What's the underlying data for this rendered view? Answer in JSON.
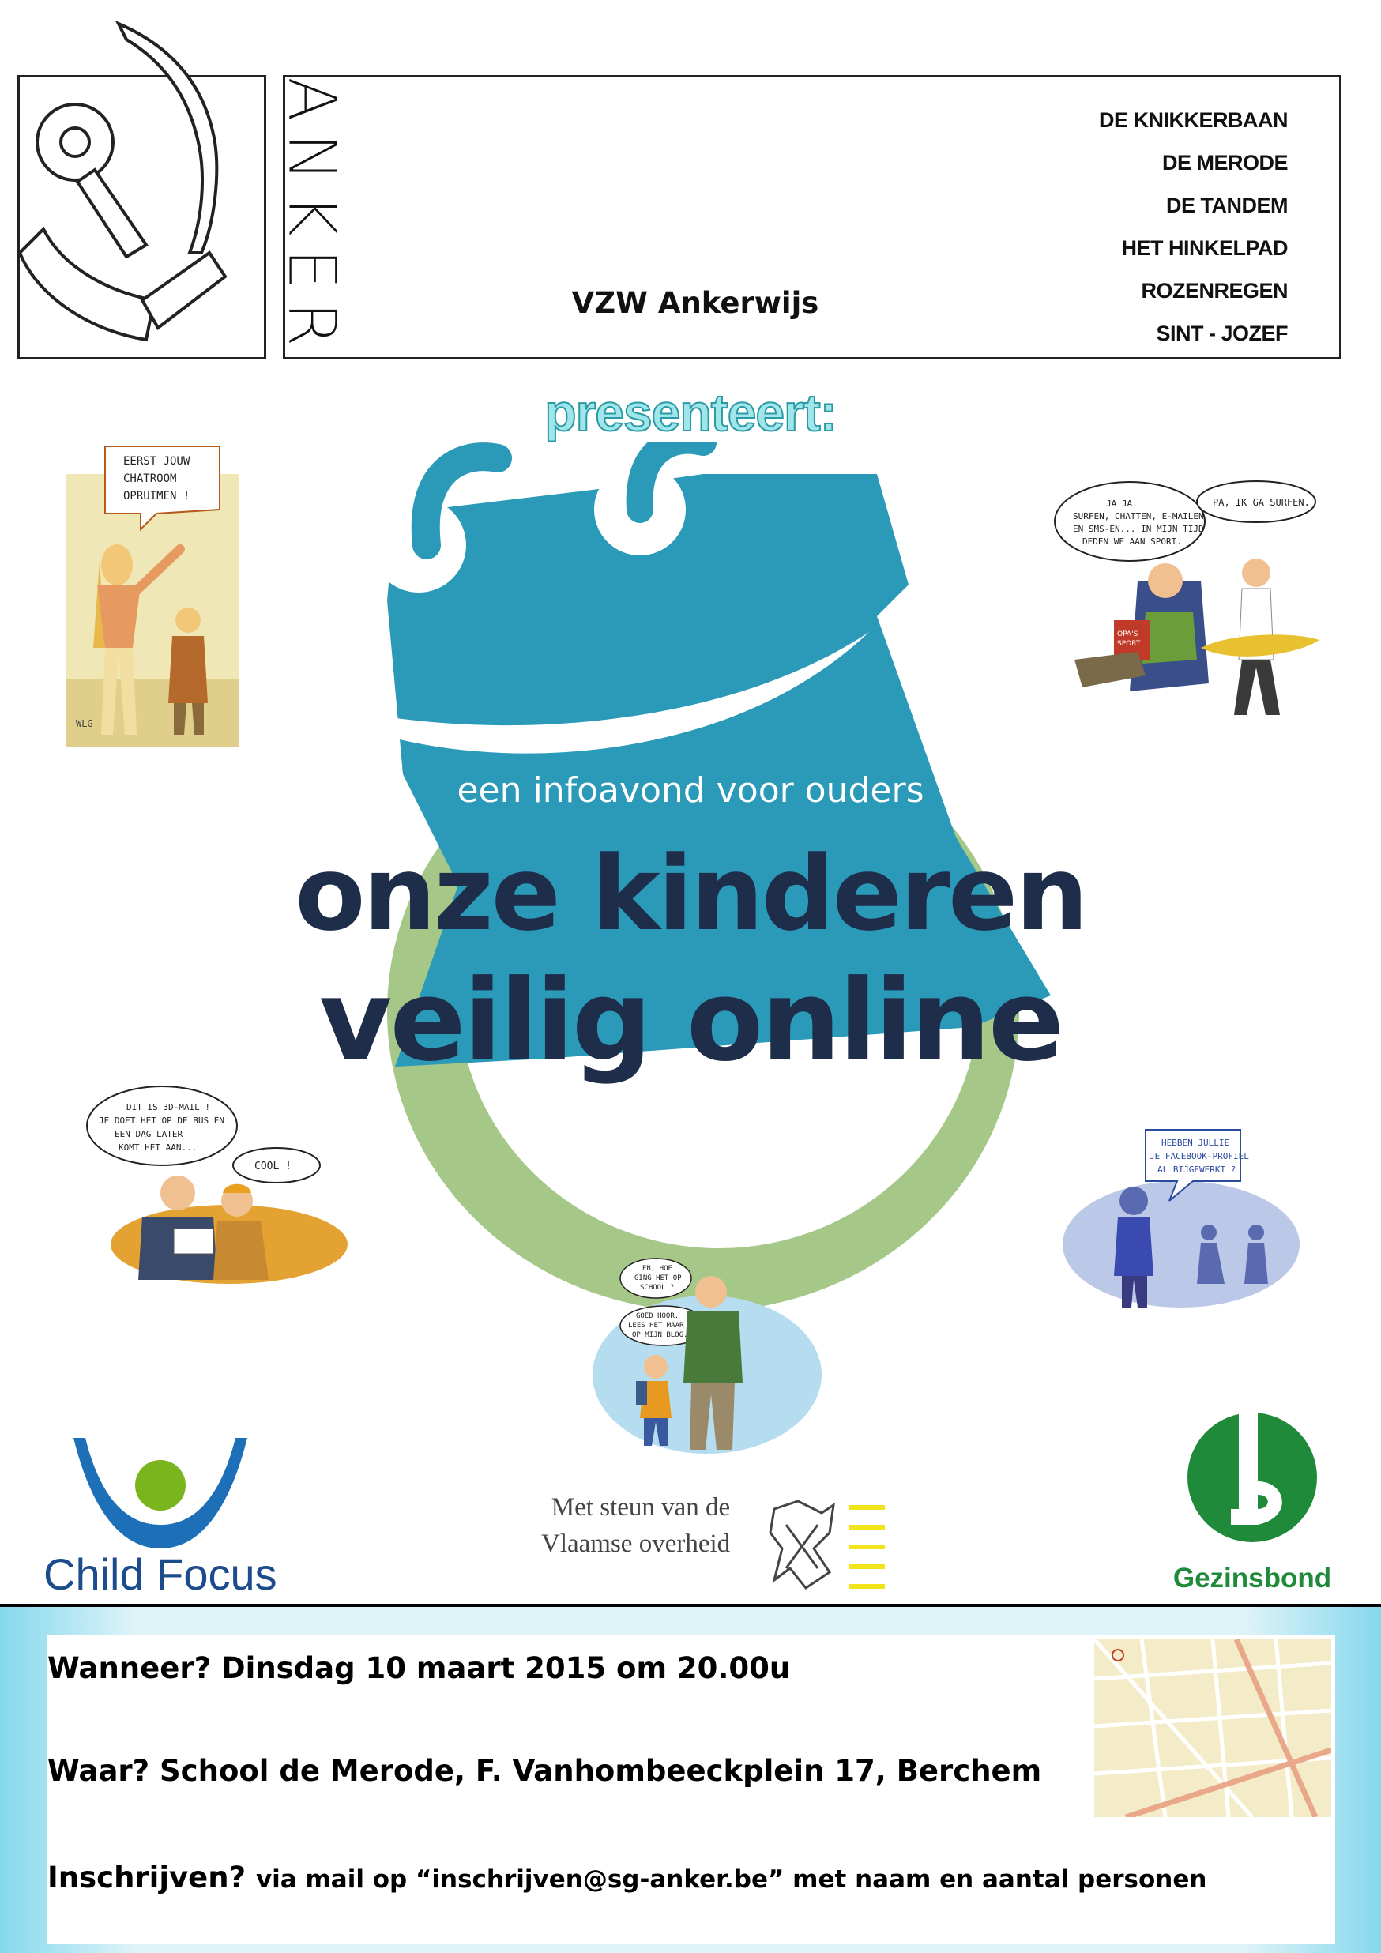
{
  "header": {
    "logo_word": "ANKER",
    "org_name": "VZW Ankerwijs",
    "schools": [
      "DE KNIKKERBAAN",
      "DE MERODE",
      "DE TANDEM",
      "HET HINKELPAD",
      "ROZENREGEN",
      "SINT - JOZEF"
    ]
  },
  "presents": "presenteert:",
  "poster": {
    "subtitle": "een infoavond voor ouders",
    "title_line1": "onze kinderen",
    "title_line2": "veilig online"
  },
  "cartoons": {
    "top_left": {
      "bubble": [
        "EERST JOUW",
        "CHATROOM",
        "OPRUIMEN !"
      ],
      "signature": "WLG"
    },
    "top_right": {
      "bubble1": [
        "JA JA.",
        "SURFEN, CHATTEN, E-MAILEN",
        "EN SMS-EN... IN MIJN TIJD",
        "DEDEN WE AAN SPORT."
      ],
      "bubble2": [
        "PA, IK GA SURFEN."
      ],
      "book": [
        "OPA'S",
        "SPORT"
      ]
    },
    "middle_left": {
      "bubble1": [
        "DIT IS 3D-MAIL !",
        "JE DOET HET OP DE BUS EN",
        "EEN DAG LATER",
        "KOMT HET AAN..."
      ],
      "bubble2": [
        "COOL !"
      ]
    },
    "middle_right": {
      "bubble": [
        "HEBBEN JULLIE",
        "JE FACEBOOK-PROFIEL",
        "AL BIJGEWERKT ?"
      ]
    },
    "bottom_center": {
      "bubble1": [
        "EN, HOE",
        "GING HET OP",
        "SCHOOL ?"
      ],
      "bubble2": [
        "GOED HOOR.",
        "LEES HET MAAR",
        "OP MIJN BLOG..."
      ]
    }
  },
  "sponsors": {
    "child_focus": "Child Focus",
    "vlaamse_overheid": [
      "Met steun van de",
      "Vlaamse overheid"
    ],
    "gezinsbond": "Gezinsbond"
  },
  "info": {
    "when": "Wanneer? Dinsdag 10 maart 2015 om 20.00u",
    "where": "Waar? School de Merode, F. Vanhombeeckplein 17, Berchem",
    "register_label": "Inschrijven?",
    "register_text": "via mail op “inschrijven@sg-anker.be” met naam en aantal personen"
  },
  "colors": {
    "teal": "#2a9ab8",
    "green_circle": "#a5c888",
    "navy_text": "#1e2d4a",
    "child_focus_blue": "#1d4c8c",
    "child_focus_green": "#7ab51d",
    "gezinsbond_green": "#1f8a3a",
    "footer_blue": "#86d8ec"
  }
}
